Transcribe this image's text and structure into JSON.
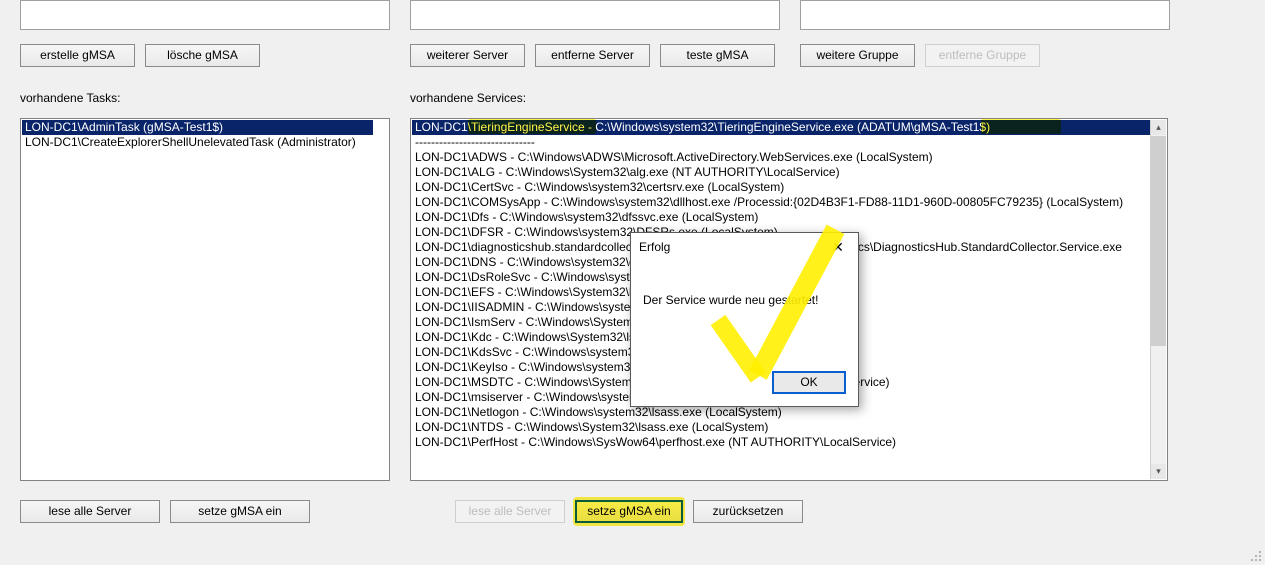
{
  "top_buttons": {
    "create_gmsa": "erstelle gMSA",
    "delete_gmsa": "lösche gMSA",
    "another_server": "weiterer Server",
    "remove_server": "entferne Server",
    "test_gmsa": "teste gMSA",
    "another_group": "weitere Gruppe",
    "remove_group": "entferne Gruppe"
  },
  "labels": {
    "tasks": "vorhandene Tasks:",
    "services": "vorhandene Services:"
  },
  "tasks": {
    "items": [
      "LON-DC1\\AdminTask (gMSA-Test1$)",
      "LON-DC1\\CreateExplorerShellUnelevatedTask (Administrator)"
    ]
  },
  "services": {
    "items": [
      "LON-DC1\\TieringEngineService - C:\\Windows\\system32\\TieringEngineService.exe (ADATUM\\gMSA-Test1$)",
      "------------------------------",
      "LON-DC1\\ADWS - C:\\Windows\\ADWS\\Microsoft.ActiveDirectory.WebServices.exe (LocalSystem)",
      "LON-DC1\\ALG - C:\\Windows\\System32\\alg.exe (NT AUTHORITY\\LocalService)",
      "LON-DC1\\CertSvc - C:\\Windows\\system32\\certsrv.exe (LocalSystem)",
      "LON-DC1\\COMSysApp - C:\\Windows\\system32\\dllhost.exe /Processid:{02D4B3F1-FD88-11D1-960D-00805FC79235} (LocalSystem)",
      "LON-DC1\\Dfs - C:\\Windows\\system32\\dfssvc.exe (LocalSystem)",
      "LON-DC1\\DFSR - C:\\Windows\\system32\\DFSRs.exe (LocalSystem)",
      "LON-DC1\\diagnosticshub.standardcollector.service - C:\\Windows\\system32\\DiagSvcs\\DiagnosticsHub.StandardCollector.Service.exe",
      "LON-DC1\\DNS - C:\\Windows\\system32\\dns.exe (LocalSystem)",
      "LON-DC1\\DsRoleSvc - C:\\Windows\\system32\\lsass.exe (LocalSystem)",
      "LON-DC1\\EFS - C:\\Windows\\System32\\lsass.exe (LocalSystem)",
      "LON-DC1\\IISADMIN - C:\\Windows\\system32\\inetsrv\\inetinfo.exe (LocalSystem)",
      "LON-DC1\\IsmServ - C:\\Windows\\System32\\ismserv.exe (LocalSystem)",
      "LON-DC1\\Kdc - C:\\Windows\\System32\\lsass.exe (LocalSystem)",
      "LON-DC1\\KdsSvc - C:\\Windows\\system32\\lsass.exe (LocalSystem)",
      "LON-DC1\\KeyIso - C:\\Windows\\system32\\lsass.exe (LocalSystem)",
      "LON-DC1\\MSDTC - C:\\Windows\\System32\\msdtc.exe (NT AUTHORITY\\NetworkService)",
      "LON-DC1\\msiserver - C:\\Windows\\system32\\msiexec.exe /V (LocalSystem)",
      "LON-DC1\\Netlogon - C:\\Windows\\system32\\lsass.exe (LocalSystem)",
      "LON-DC1\\NTDS - C:\\Windows\\System32\\lsass.exe (LocalSystem)",
      "LON-DC1\\PerfHost - C:\\Windows\\SysWow64\\perfhost.exe (NT AUTHORITY\\LocalService)"
    ]
  },
  "bottom_buttons": {
    "tasks_read_all": "lese alle Server",
    "tasks_set_gmsa": "setze gMSA ein",
    "services_read_all": "lese alle Server",
    "services_set_gmsa": "setze gMSA ein",
    "services_reset": "zurücksetzen"
  },
  "dialog": {
    "title": "Erfolg",
    "message": "Der Service wurde neu gestartet!",
    "ok": "OK"
  }
}
